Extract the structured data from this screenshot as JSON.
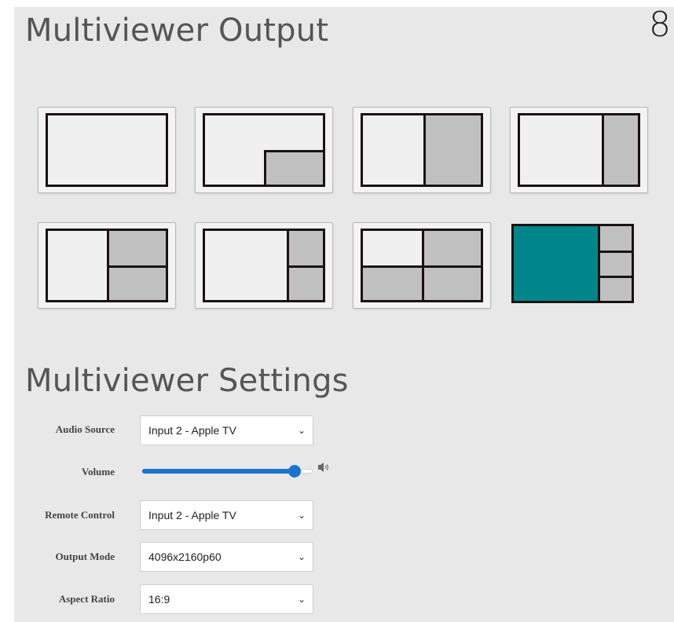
{
  "corner_number": "8",
  "output_section": {
    "title": "Multiviewer Output"
  },
  "layouts": [
    {
      "name": "single",
      "selected": false
    },
    {
      "name": "pip",
      "selected": false
    },
    {
      "name": "side-by-side",
      "selected": false
    },
    {
      "name": "side-by-side-narrow",
      "selected": false
    },
    {
      "name": "three-split",
      "selected": false
    },
    {
      "name": "three-split-narrow",
      "selected": false
    },
    {
      "name": "quad",
      "selected": false
    },
    {
      "name": "four-split-sidebar",
      "selected": true
    }
  ],
  "colors": {
    "selected_window": "#00868a",
    "accent": "#1a73d1"
  },
  "settings_section": {
    "title": "Multiviewer Settings",
    "audio_source": {
      "label": "Audio Source",
      "value": "Input 2 - Apple TV"
    },
    "volume": {
      "label": "Volume",
      "level": 0.9,
      "icon": "speaker-icon"
    },
    "remote_control": {
      "label": "Remote Control",
      "value": "Input 2 - Apple TV"
    },
    "output_mode": {
      "label": "Output Mode",
      "value": "4096x2160p60"
    },
    "aspect_ratio": {
      "label": "Aspect Ratio",
      "value": "16:9"
    }
  }
}
